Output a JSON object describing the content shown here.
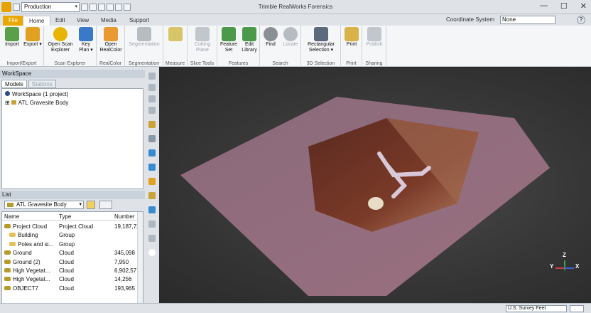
{
  "titlebar": {
    "project_select": "Production",
    "title": "Trimble RealWorks Forensics",
    "minimize": "—",
    "maximize": "☐",
    "close": "✕"
  },
  "tabs": [
    {
      "label": "File"
    },
    {
      "label": "Home"
    },
    {
      "label": "Edit"
    },
    {
      "label": "View"
    },
    {
      "label": "Media"
    },
    {
      "label": "Support"
    }
  ],
  "coordinate_system": {
    "label": "Coordinate System",
    "value": "None"
  },
  "ribbon": {
    "groups": [
      {
        "label": "Import/Export"
      },
      {
        "label": "Scan Explorer"
      },
      {
        "label": "RealColor"
      },
      {
        "label": "Segmentation"
      },
      {
        "label": "Measure"
      },
      {
        "label": "Slice Tools"
      },
      {
        "label": "Features"
      },
      {
        "label": "Search"
      },
      {
        "label": "3D Selection"
      },
      {
        "label": "Print"
      },
      {
        "label": "Sharing"
      }
    ],
    "buttons": [
      {
        "label": "Import"
      },
      {
        "label": "Export ▾"
      },
      {
        "label": "Open Scan\nExplorer"
      },
      {
        "label": "Key\nPlan ▾"
      },
      {
        "label": "Open\nRealColor"
      },
      {
        "label": "Segmentation"
      },
      {
        "label": ""
      },
      {
        "label": "Cutting\nPlane"
      },
      {
        "label": "Feature\nSet"
      },
      {
        "label": "Edit\nLibrary"
      },
      {
        "label": "Find"
      },
      {
        "label": "Locate"
      },
      {
        "label": "Rectangular\nSelection ▾"
      },
      {
        "label": "Print"
      },
      {
        "label": "Publish"
      }
    ]
  },
  "workspace": {
    "title": "WorkSpace",
    "tabs": [
      "Models",
      "Stations"
    ],
    "root": "WorkSpace  (1 project)",
    "project": "ATL Gravesite Body"
  },
  "list": {
    "title": "List",
    "combo_value": "ATL Gravesite Body",
    "columns": [
      "Name",
      "Type",
      "Number"
    ],
    "rows": [
      {
        "name": "Project Cloud",
        "type": "Project Cloud",
        "number": "19,187,72"
      },
      {
        "name": "Building",
        "type": "Group",
        "number": ""
      },
      {
        "name": "Poles and si...",
        "type": "Group",
        "number": ""
      },
      {
        "name": "Ground",
        "type": "Cloud",
        "number": "345,098"
      },
      {
        "name": "Ground (2)",
        "type": "Cloud",
        "number": "7,950"
      },
      {
        "name": "High Vegetat...",
        "type": "Cloud",
        "number": "6,902,57"
      },
      {
        "name": "High Vegetat...",
        "type": "Cloud",
        "number": "14,256"
      },
      {
        "name": "OBJECT7",
        "type": "Cloud",
        "number": "193,965"
      }
    ]
  },
  "viewport": {
    "axis_x": "X",
    "axis_y": "Y",
    "axis_z": "Z"
  },
  "status": {
    "units": "U.S. Survey Feet"
  }
}
